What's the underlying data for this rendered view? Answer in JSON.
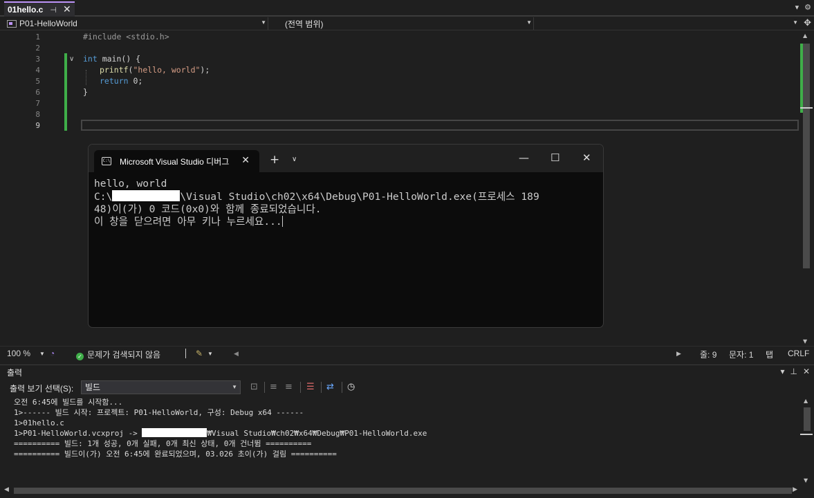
{
  "doc_tab": {
    "name": "01hello.c",
    "pin": "⊣",
    "close": "✕"
  },
  "strip_right": {
    "dropdown": "▾",
    "gear": "⚙"
  },
  "navbar": {
    "project": "P01-HelloWorld",
    "scope": "(전역 범위)",
    "member": ""
  },
  "editor": {
    "line_numbers": [
      "1",
      "2",
      "3",
      "4",
      "5",
      "6",
      "7",
      "8",
      "9"
    ],
    "current_line": "9",
    "lines": {
      "l1": "#include <stdio.h>",
      "l3_kw": "int",
      "l3_rest": " main() {",
      "l4_fn": "printf",
      "l4_a": "(",
      "l4_str": "\"hello, world\"",
      "l4_b": ");",
      "l5_kw": "return",
      "l5_rest": " 0;",
      "l6": "}"
    }
  },
  "edstatus": {
    "zoom": "100 %",
    "issues": "문제가 검색되지 않음",
    "line": "줄: 9",
    "char": "문자: 1",
    "tab": "탭",
    "eol": "CRLF"
  },
  "console": {
    "tab_title": "Microsoft Visual Studio 디버그",
    "icon_text": "C:\\",
    "line1": "hello, world",
    "line2_prefix": "C:\\",
    "line2_rest": "\\Visual Studio\\ch02\\x64\\Debug\\P01-HelloWorld.exe(프로세스 189",
    "line3": "48)이(가) 0 코드(0x0)와 함께 종료되었습니다.",
    "line4": "이 창을 닫으려면 아무 키나 누르세요..."
  },
  "output": {
    "header": "출력",
    "show_label": "출력 보기 선택(S):",
    "selected": "빌드",
    "lines": {
      "o1": "오전 6:45에 빌드를 시작함...",
      "o2": "1>------ 빌드 시작: 프로젝트: P01-HelloWorld, 구성: Debug x64 ------",
      "o3": "1>01hello.c",
      "o4_prefix": "1>P01-HelloWorld.vcxproj -> ",
      "o4_rest": "₩Visual Studio₩ch02₩x64₩Debug₩P01-HelloWorld.exe",
      "o5": "========== 빌드: 1개 성공, 0개 실패, 0개 최신 상태, 0개 건너뜀 ==========",
      "o6": "========== 빌드이(가) 오전 6:45에 완료되었으며, 03.026 초이(가) 걸림 =========="
    }
  }
}
